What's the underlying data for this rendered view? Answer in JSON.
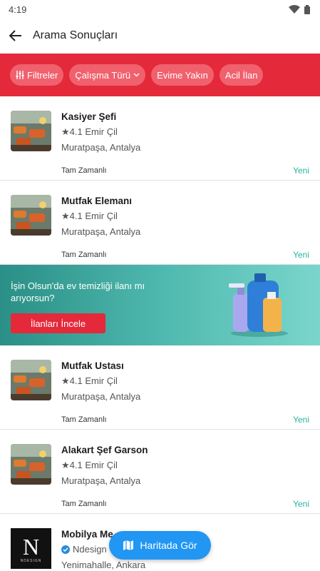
{
  "status_bar": {
    "time": "4:19"
  },
  "app_bar": {
    "title": "Arama Sonuçları"
  },
  "filters": {
    "chips": [
      "Filtreler",
      "Çalışma Türü",
      "Evime Yakın",
      "Acil İlan"
    ]
  },
  "jobs": [
    {
      "title": "Kasiyer Şefi",
      "rating": "4.1",
      "company": "Emir Çil",
      "location": "Muratpaşa, Antalya",
      "type": "Tam Zamanlı",
      "badge": "Yeni"
    },
    {
      "title": "Mutfak Elemanı",
      "rating": "4.1",
      "company": "Emir Çil",
      "location": "Muratpaşa, Antalya",
      "type": "Tam Zamanlı",
      "badge": "Yeni"
    }
  ],
  "banner": {
    "text": "İşin Olsun'da ev temizliği ilanı mı arıyorsun?",
    "button": "İlanları İncele"
  },
  "jobs2": [
    {
      "title": "Mutfak Ustası",
      "rating": "4.1",
      "company": "Emir Çil",
      "location": "Muratpaşa, Antalya",
      "type": "Tam Zamanlı",
      "badge": "Yeni"
    },
    {
      "title": "Alakart Şef Garson",
      "rating": "4.1",
      "company": "Emir Çil",
      "location": "Muratpaşa, Antalya",
      "type": "Tam Zamanlı",
      "badge": "Yeni"
    }
  ],
  "last_job": {
    "title": "Mobilya Me",
    "company": "Ndesign",
    "location": "Yenimahalle, Ankara",
    "logo_text": "N",
    "logo_sub": "NDESIGN"
  },
  "map_button": {
    "label": "Haritada Gör"
  },
  "colors": {
    "brand_red": "#e4293a",
    "new_badge": "#27b39d",
    "fab_blue": "#2196f3"
  }
}
